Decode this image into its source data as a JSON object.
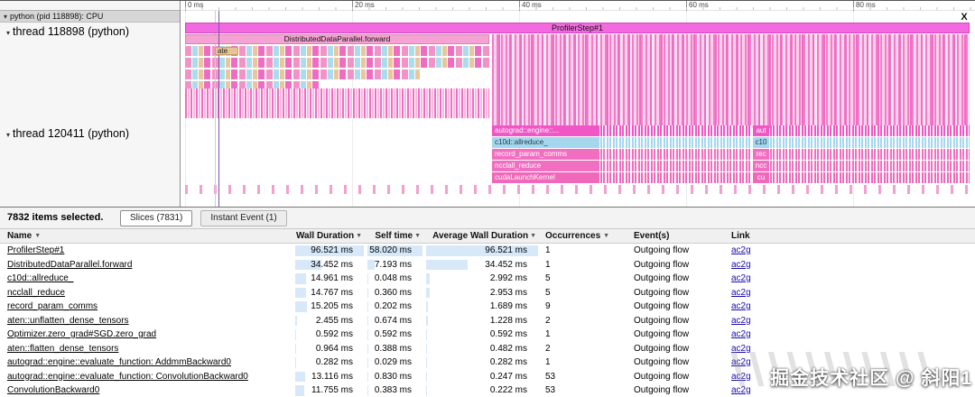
{
  "ruler": {
    "ticks": [
      "0 ms",
      "20 ms",
      "40 ms",
      "60 ms",
      "80 ms"
    ]
  },
  "close_label": "X",
  "left_panel": {
    "process_header": "python (pid 118898): CPU",
    "threads": [
      "thread 118898 (python)",
      "thread 120411 (python)"
    ]
  },
  "timeline": {
    "profiler_step": "ProfilerStep#1",
    "ddp_forward": "DistributedDataParallel.forward",
    "small_label": "ate",
    "thread2_slices": [
      {
        "label": "autograd::engine::...",
        "short": "aut",
        "color": "#f156c6",
        "text_color": "#ffffff"
      },
      {
        "label": "c10d::allreduce_",
        "short": "c10",
        "color": "#a4d7ee",
        "text_color": "#1a3a4a"
      },
      {
        "label": "record_param_comms",
        "short": "rec",
        "color": "#f16fc0",
        "text_color": "#ffffff"
      },
      {
        "label": "ncclall_reduce",
        "short": "ncc",
        "color": "#f16fc0",
        "text_color": "#ffffff"
      },
      {
        "label": "cudaLaunchKernel",
        "short": "cu",
        "color": "#ef68ba",
        "text_color": "#ffffff"
      }
    ]
  },
  "bottom_panel": {
    "selected_text": "7832 items selected.",
    "tabs": [
      {
        "label": "Slices (7831)",
        "active": true
      },
      {
        "label": "Instant Event (1)",
        "active": false
      }
    ],
    "table": {
      "columns": {
        "name": "Name",
        "wall": "Wall Duration",
        "self": "Self time",
        "avg": "Average Wall Duration",
        "occ": "Occurrences",
        "event": "Event(s)",
        "link": "Link"
      },
      "rows": [
        {
          "name": "ProfilerStep#1",
          "wall": "96.521 ms",
          "wall_pct": 100,
          "self": "58.020 ms",
          "self_pct": 100,
          "avg": "96.521 ms",
          "avg_pct": 100,
          "occ": "1",
          "event": "Outgoing flow",
          "link": "ac2g"
        },
        {
          "name": "DistributedDataParallel.forward",
          "wall": "34.452 ms",
          "wall_pct": 35.7,
          "self": "7.193 ms",
          "self_pct": 12.4,
          "avg": "34.452 ms",
          "avg_pct": 35.7,
          "occ": "1",
          "event": "Outgoing flow",
          "link": "ac2g"
        },
        {
          "name": "c10d::allreduce_",
          "wall": "14.961 ms",
          "wall_pct": 15.5,
          "self": "0.048 ms",
          "self_pct": 0.5,
          "avg": "2.992 ms",
          "avg_pct": 3.1,
          "occ": "5",
          "event": "Outgoing flow",
          "link": "ac2g"
        },
        {
          "name": "ncclall_reduce",
          "wall": "14.767 ms",
          "wall_pct": 15.3,
          "self": "0.360 ms",
          "self_pct": 0.7,
          "avg": "2.953 ms",
          "avg_pct": 3.1,
          "occ": "5",
          "event": "Outgoing flow",
          "link": "ac2g"
        },
        {
          "name": "record_param_comms",
          "wall": "15.205 ms",
          "wall_pct": 15.8,
          "self": "0.202 ms",
          "self_pct": 0.5,
          "avg": "1.689 ms",
          "avg_pct": 1.8,
          "occ": "9",
          "event": "Outgoing flow",
          "link": "ac2g"
        },
        {
          "name": "aten::unflatten_dense_tensors",
          "wall": "2.455 ms",
          "wall_pct": 2.6,
          "self": "0.674 ms",
          "self_pct": 1.2,
          "avg": "1.228 ms",
          "avg_pct": 1.3,
          "occ": "2",
          "event": "Outgoing flow",
          "link": "ac2g"
        },
        {
          "name": "Optimizer.zero_grad#SGD.zero_grad",
          "wall": "0.592 ms",
          "wall_pct": 0.7,
          "self": "0.592 ms",
          "self_pct": 1.1,
          "avg": "0.592 ms",
          "avg_pct": 0.7,
          "occ": "1",
          "event": "Outgoing flow",
          "link": "ac2g"
        },
        {
          "name": "aten::flatten_dense_tensors",
          "wall": "0.964 ms",
          "wall_pct": 1.0,
          "self": "0.388 ms",
          "self_pct": 0.7,
          "avg": "0.482 ms",
          "avg_pct": 0.6,
          "occ": "2",
          "event": "Outgoing flow",
          "link": "ac2g"
        },
        {
          "name": "autograd::engine::evaluate_function: AddmmBackward0",
          "wall": "0.282 ms",
          "wall_pct": 0.4,
          "self": "0.029 ms",
          "self_pct": 0.2,
          "avg": "0.282 ms",
          "avg_pct": 0.4,
          "occ": "1",
          "event": "Outgoing flow",
          "link": "ac2g"
        },
        {
          "name": "autograd::engine::evaluate_function: ConvolutionBackward0",
          "wall": "13.116 ms",
          "wall_pct": 13.6,
          "self": "0.830 ms",
          "self_pct": 1.5,
          "avg": "0.247 ms",
          "avg_pct": 0.4,
          "occ": "53",
          "event": "Outgoing flow",
          "link": "ac2g"
        },
        {
          "name": "ConvolutionBackward0",
          "wall": "11.755 ms",
          "wall_pct": 12.2,
          "self": "0.383 ms",
          "self_pct": 0.7,
          "avg": "0.222 ms",
          "avg_pct": 0.3,
          "occ": "53",
          "event": "Outgoing flow",
          "link": "ac2g"
        }
      ]
    }
  },
  "watermark": {
    "text": "掘金技术社区 @ 斜阳1"
  },
  "colors": {
    "accent_pink": "#f36ae0",
    "cyan_slice": "#a4d7ee",
    "bar_fill": "#d7e8f8",
    "link_blue": "#1a0dab"
  }
}
